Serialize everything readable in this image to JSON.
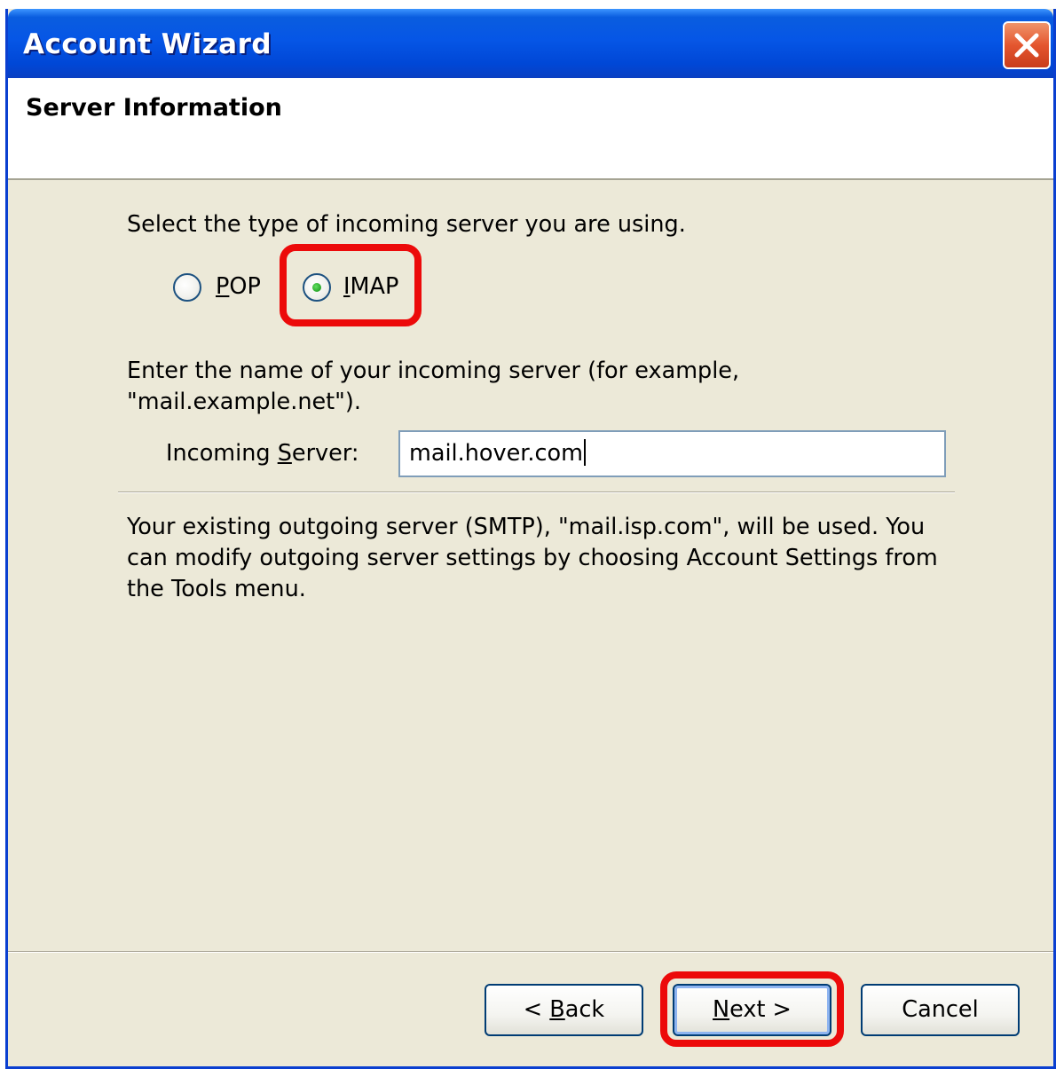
{
  "window": {
    "title": "Account Wizard"
  },
  "header": {
    "title": "Server Information"
  },
  "server_type": {
    "prompt": "Select the type of incoming server you are using.",
    "options": [
      {
        "label": "POP",
        "selected": false
      },
      {
        "label": "IMAP",
        "selected": true
      }
    ]
  },
  "incoming": {
    "instruction_line1": "Enter the name of your incoming server (for example,",
    "instruction_line2": "\"mail.example.net\").",
    "field_label": "Incoming Server:",
    "field_value": "mail.hover.com"
  },
  "smtp_note": {
    "line1": "Your existing outgoing server (SMTP), \"mail.isp.com\", will be used. You",
    "line2": "can modify outgoing server settings by choosing Account Settings from",
    "line3": "the Tools menu."
  },
  "buttons": {
    "back": "< Back",
    "next": "Next >",
    "cancel": "Cancel"
  },
  "colors": {
    "highlight": "#ec0a0a",
    "dialog_bg": "#ece9d8",
    "titlebar": "#0656e6"
  }
}
